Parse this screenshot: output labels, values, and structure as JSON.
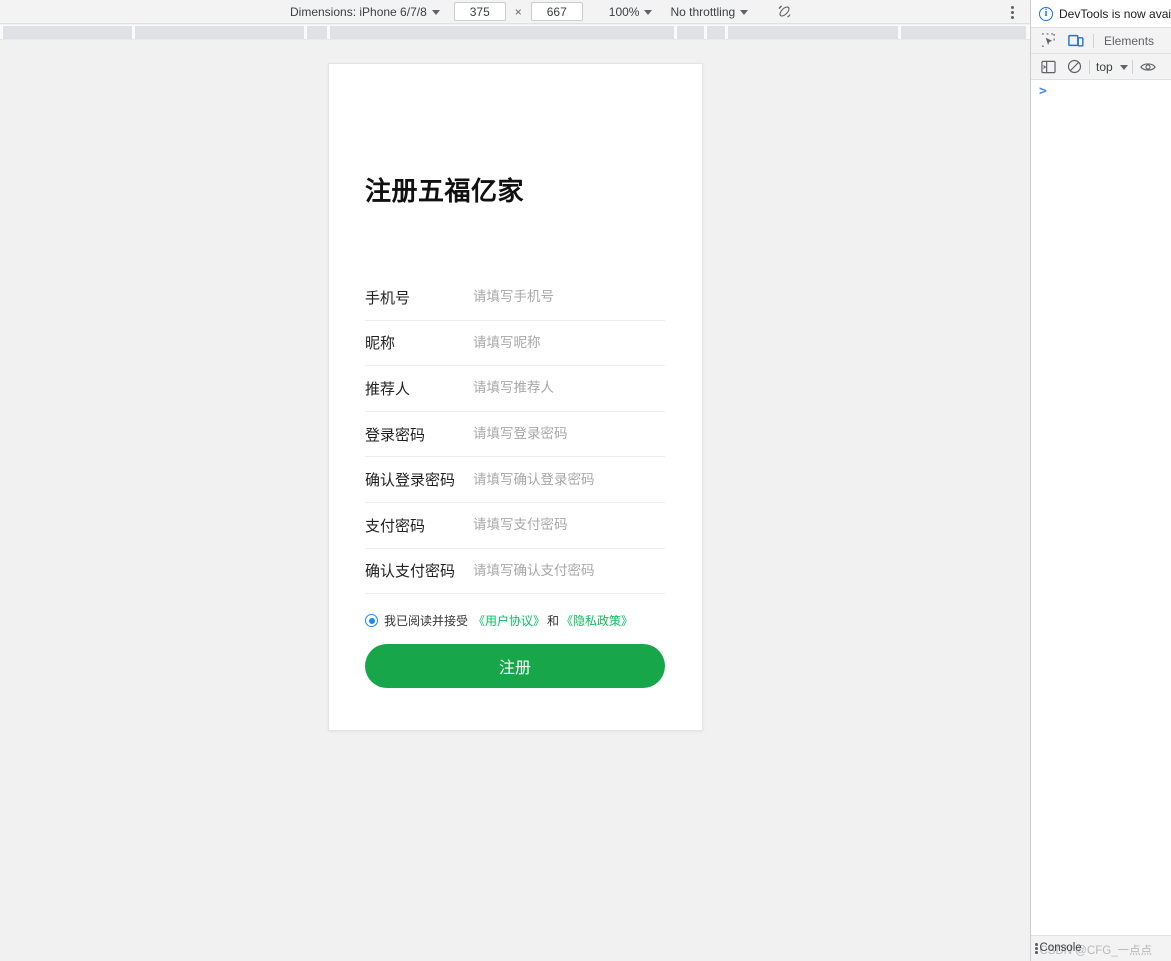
{
  "device_toolbar": {
    "dimensions_label": "Dimensions: iPhone 6/7/8",
    "width_value": "375",
    "times_symbol": "×",
    "height_value": "667",
    "zoom_label": "100%",
    "throttling_label": "No throttling",
    "rotate_icon": "rotate-device-icon",
    "more_icon": "more-vertical-icon"
  },
  "page": {
    "title": "注册五福亿家",
    "fields": [
      {
        "label": "手机号",
        "placeholder": "请填写手机号",
        "value": ""
      },
      {
        "label": "昵称",
        "placeholder": "请填写昵称",
        "value": ""
      },
      {
        "label": "推荐人",
        "placeholder": "请填写推荐人",
        "value": ""
      },
      {
        "label": "登录密码",
        "placeholder": "请填写登录密码",
        "value": ""
      },
      {
        "label": "确认登录密码",
        "placeholder": "请填写确认登录密码",
        "value": ""
      },
      {
        "label": "支付密码",
        "placeholder": "请填写支付密码",
        "value": ""
      },
      {
        "label": "确认支付密码",
        "placeholder": "请填写确认支付密码",
        "value": ""
      }
    ],
    "agreement": {
      "checked": true,
      "text": "我已阅读并接受",
      "link_user": "《用户协议》",
      "separator": "和",
      "link_privacy": "《隐私政策》",
      "link_color": "#07c160",
      "radio_color": "#1989fa"
    },
    "submit_label": "注册",
    "submit_color": "#17a74a"
  },
  "devtools": {
    "notice_text": "DevTools is now avail",
    "notice_icon": "info-icon",
    "inspect_icon": "inspect-element-icon",
    "device_toggle_icon": "device-toolbar-icon",
    "tab_elements": "Elements",
    "sidebar_icon": "console-sidebar-icon",
    "clear_icon": "clear-console-icon",
    "context_label": "top",
    "eye_icon": "live-expression-eye-icon",
    "console_prompt": ">",
    "status_drawer_tab": "Console",
    "status_watermark": "CSDN @CFG_一点点"
  }
}
